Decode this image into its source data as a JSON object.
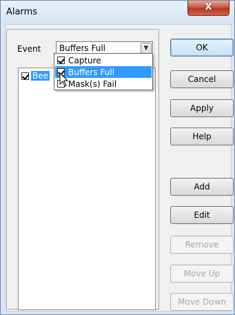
{
  "window": {
    "title": "Alarms",
    "close_glyph": "X"
  },
  "event": {
    "label": "Event",
    "selected": "Buffers Full",
    "arrow_icon": "chevron-down-icon",
    "options": [
      {
        "label": "Capture",
        "checked": true
      },
      {
        "label": "Buffers Full",
        "checked": true,
        "highlighted": true
      },
      {
        "label": "Mask(s) Fail",
        "checked": false
      }
    ]
  },
  "list": {
    "items": [
      {
        "label": "Bee",
        "checked": true,
        "selected": true
      }
    ]
  },
  "buttons": {
    "ok": "OK",
    "cancel": "Cancel",
    "apply": "Apply",
    "help": "Help",
    "add": "Add",
    "edit": "Edit",
    "remove": "Remove",
    "move_up": "Move Up",
    "move_down": "Move Down"
  },
  "colors": {
    "selection": "#3399ff",
    "close": "#c8503a"
  }
}
